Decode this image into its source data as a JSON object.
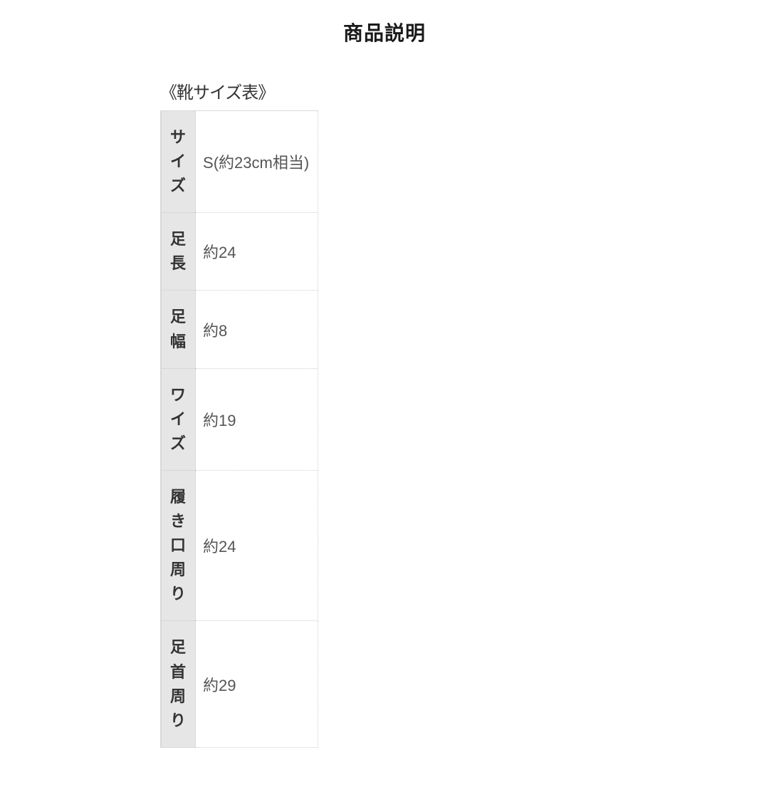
{
  "heading": "商品説明",
  "table_caption": "《靴サイズ表》",
  "rows": [
    {
      "label": "サ\nイ\nズ",
      "value": "S(約23cm相当)"
    },
    {
      "label": "足\n長",
      "value": "約24"
    },
    {
      "label": "足\n幅",
      "value": "約8"
    },
    {
      "label": "ワ\nイ\nズ",
      "value": "約19"
    },
    {
      "label": "履\nき\n口\n周\nり",
      "value": "約24"
    },
    {
      "label": "足\n首\n周\nり",
      "value": "約29"
    }
  ]
}
